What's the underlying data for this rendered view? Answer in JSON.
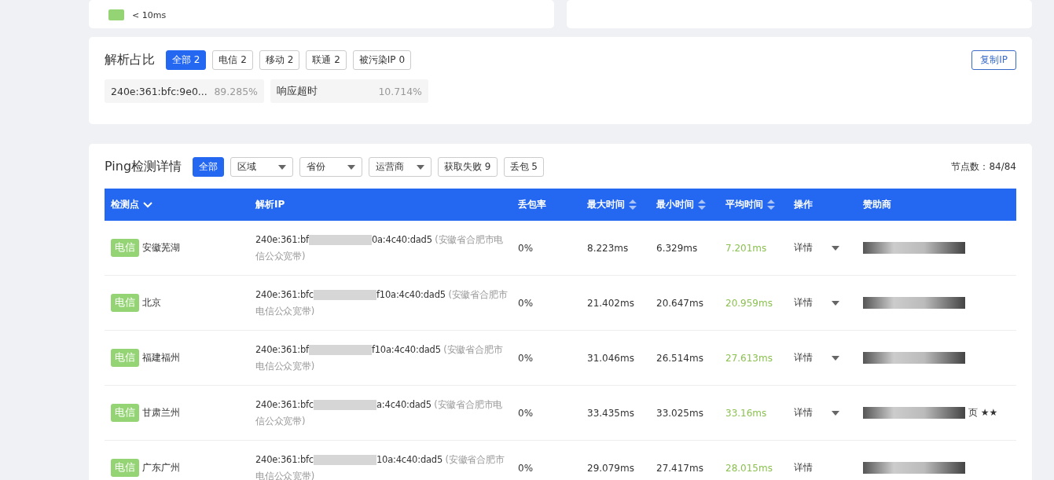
{
  "top_card": {
    "legend": [
      {
        "label": "< 10ms",
        "color": "#95d475"
      }
    ]
  },
  "resolve_card": {
    "title": "解析占比",
    "tabs": [
      {
        "label": "全部 2",
        "selected": true
      },
      {
        "label": "电信 2",
        "selected": false
      },
      {
        "label": "移动 2",
        "selected": false
      },
      {
        "label": "联通 2",
        "selected": false
      },
      {
        "label": "被污染IP 0",
        "selected": false
      }
    ],
    "copy_button": "复制IP",
    "shares": [
      {
        "label": "240e:361:bfc:9e0...",
        "value": "89.285%"
      },
      {
        "label": "响应超时",
        "value": "10.714%"
      }
    ]
  },
  "ping_card": {
    "title": "Ping检测详情",
    "filters": [
      {
        "kind": "button",
        "label": "全部",
        "selected": true
      },
      {
        "kind": "dropdown",
        "label": "区域",
        "selected": false
      },
      {
        "kind": "dropdown",
        "label": "省份",
        "selected": false
      },
      {
        "kind": "dropdown",
        "label": "运营商",
        "selected": false
      },
      {
        "kind": "button",
        "label": "获取失败 9",
        "selected": false
      },
      {
        "kind": "button",
        "label": "丢包 5",
        "selected": false
      }
    ],
    "node_count": "节点数：84/84",
    "columns": [
      {
        "label": "检测点",
        "kind": "dropdown"
      },
      {
        "label": "解析IP",
        "kind": "plain"
      },
      {
        "label": "丢包率",
        "kind": "plain"
      },
      {
        "label": "最大时间",
        "kind": "sort"
      },
      {
        "label": "最小时间",
        "kind": "sort"
      },
      {
        "label": "平均时间",
        "kind": "sort"
      },
      {
        "label": "操作",
        "kind": "plain"
      },
      {
        "label": "赞助商",
        "kind": "plain"
      }
    ],
    "rows": [
      {
        "carrier": "电信",
        "location": "安徽芜湖",
        "ip_start": "240e:361:bf",
        "ip_end": "0a:4c40:dad5",
        "ip_place": "(安徽省合肥市电信公众宽带)",
        "loss": "0%",
        "max": "8.223ms",
        "min": "6.329ms",
        "avg": "7.201ms",
        "action": "详情",
        "menu": true
      },
      {
        "carrier": "电信",
        "location": "北京",
        "ip_start": "240e:361:bfc",
        "ip_end": "f10a:4c40:dad5",
        "ip_place": "(安徽省合肥市电信公众宽带)",
        "loss": "0%",
        "max": "21.402ms",
        "min": "20.647ms",
        "avg": "20.959ms",
        "action": "详情",
        "menu": true
      },
      {
        "carrier": "电信",
        "location": "福建福州",
        "ip_start": "240e:361:bf",
        "ip_end": "f10a:4c40:dad5",
        "ip_place": "(安徽省合肥市电信公众宽带)",
        "loss": "0%",
        "max": "31.046ms",
        "min": "26.514ms",
        "avg": "27.613ms",
        "action": "详情",
        "menu": true
      },
      {
        "carrier": "电信",
        "location": "甘肃兰州",
        "ip_start": "240e:361:bfc",
        "ip_end": "a:4c40:dad5",
        "ip_place": "(安徽省合肥市电信公众宽带)",
        "loss": "0%",
        "max": "33.435ms",
        "min": "33.025ms",
        "avg": "33.16ms",
        "action": "详情",
        "menu": true,
        "sponsor_visible": "页 ★★"
      },
      {
        "carrier": "电信",
        "location": "广东广州",
        "ip_start": "240e:361:bfc",
        "ip_end": "10a:4c40:dad5",
        "ip_place": "(安徽省合肥市电信公众宽带)",
        "loss": "0%",
        "max": "29.079ms",
        "min": "27.417ms",
        "avg": "28.015ms",
        "action": "详情",
        "menu": false
      }
    ]
  }
}
